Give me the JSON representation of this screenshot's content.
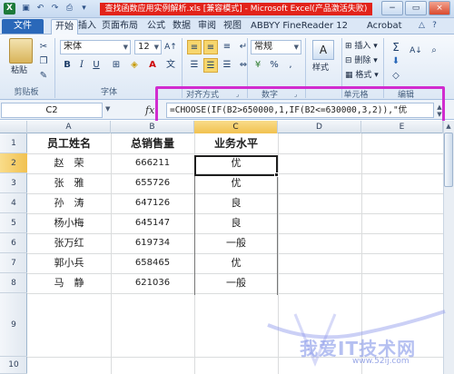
{
  "window": {
    "title": "查找函数应用实例解析.xls [兼容模式] - Microsoft Excel(产品激活失败)",
    "controls": [
      "−",
      "▭",
      "×"
    ]
  },
  "tabs": {
    "file": "文件",
    "items": [
      "开始",
      "插入",
      "页面布局",
      "公式",
      "数据",
      "审阅",
      "视图",
      "ABBYY FineReader 12",
      "Acrobat"
    ]
  },
  "ribbon": {
    "clipboard": {
      "paste": "粘贴",
      "label": "剪贴板"
    },
    "font": {
      "name": "宋体",
      "size": "12",
      "label": "字体"
    },
    "alignment": {
      "label": "对齐方式"
    },
    "number": {
      "format": "常规",
      "label": "数字"
    },
    "styles": {
      "label": "样式"
    },
    "cells": {
      "insert": "插入",
      "delete": "删除",
      "format": "格式",
      "label": "单元格"
    },
    "editing": {
      "label": "编辑"
    }
  },
  "formula_bar": {
    "name_box": "C2",
    "fx": "fx",
    "formula": "=CHOOSE(IF(B2>650000,1,IF(B2<=630000,3,2)),\"优"
  },
  "columns": [
    "A",
    "B",
    "C",
    "D",
    "E"
  ],
  "rows": [
    "1",
    "2",
    "3",
    "4",
    "5",
    "6",
    "7",
    "8",
    "9",
    "10"
  ],
  "sheet": {
    "headers": [
      "员工姓名",
      "总销售量",
      "业务水平"
    ],
    "data": [
      [
        "赵　荣",
        "666211",
        "优"
      ],
      [
        "张　雅",
        "655726",
        "优"
      ],
      [
        "孙　涛",
        "647126",
        "良"
      ],
      [
        "杨小梅",
        "645147",
        "良"
      ],
      [
        "张万红",
        "619734",
        "一般"
      ],
      [
        "郭小兵",
        "658465",
        "优"
      ],
      [
        "马　静",
        "621036",
        "一般"
      ]
    ]
  },
  "watermark": {
    "text": "我爱IT技术网",
    "url": "www.52ij.com"
  }
}
